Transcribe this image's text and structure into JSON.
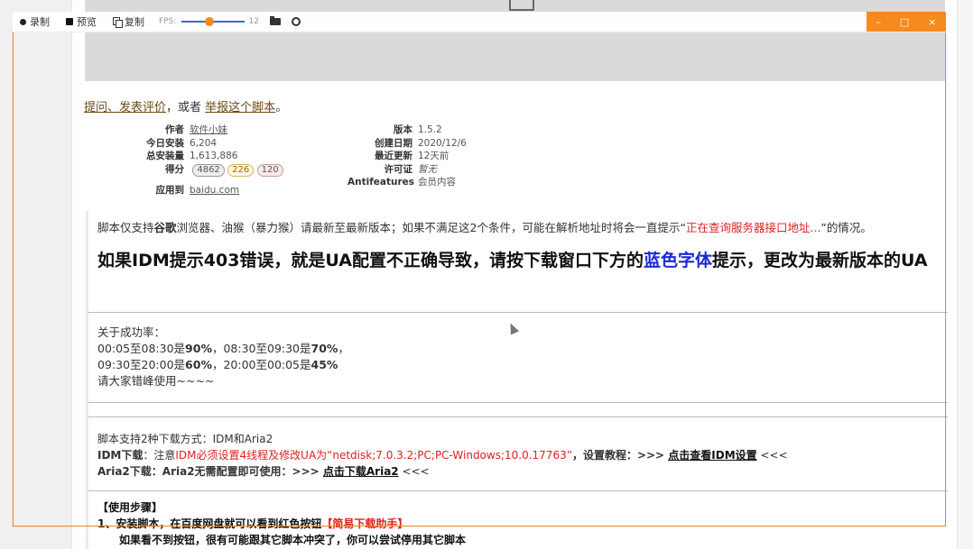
{
  "recorder": {
    "record_label": "录制",
    "preview_label": "预览",
    "copy_label": "复制",
    "fps_label": "FPS:",
    "fps_value": "12",
    "fps_fraction": 0.43,
    "minimize": "–",
    "maximize": "□",
    "close": "×",
    "accent": "#f58a1f"
  },
  "links": {
    "ask": "提问、发表评价",
    "or": "，或者",
    "report": "举报这个脚本",
    "end": "。"
  },
  "meta_left": [
    {
      "k": "作者",
      "v": "软件小妹"
    },
    {
      "k": "今日安装",
      "v": "6,204"
    },
    {
      "k": "总安装量",
      "v": "1,613,886"
    },
    {
      "k": "得分",
      "v": ""
    }
  ],
  "score": {
    "good": "4862",
    "ok": "226",
    "bad": "120"
  },
  "applies": {
    "k": "应用到",
    "v": "baidu.com"
  },
  "meta_right": [
    {
      "k": "版本",
      "v": "1.5.2"
    },
    {
      "k": "创建日期",
      "v": "2020/12/6"
    },
    {
      "k": "最近更新",
      "v": "12天前"
    },
    {
      "k": "许可证",
      "v": "暂无"
    },
    {
      "k": "Antifeatures",
      "v": "会员内容"
    }
  ],
  "desc": {
    "p1_a": "脚本仅支持",
    "p1_b": "谷歌",
    "p1_c": "浏览器、油猴（暴力猴）请最新至最新版本；如果不满足这2个条件，可能在解析地址时将会一直提示“",
    "p1_red": "正在查询服务器接口地址...",
    "p1_d": "”的情况。",
    "h2_a": "如果IDM提示403错误，就是UA配置不正确导致，请按下载窗口下方的",
    "h2_blue": "蓝色字体",
    "h2_b": "提示，更改为最新版本的UA",
    "stats_title": "关于成功率：",
    "stats_line1_a": "00:05至08:30是",
    "stats_line1_b": "90%",
    "stats_line1_c": "，08:30至09:30是",
    "stats_line1_d": "70%",
    "stats_line1_e": "，",
    "stats_line2_a": "09:30至20:00是",
    "stats_line2_b": "60%",
    "stats_line2_c": "，20:00至00:05是",
    "stats_line2_d": "45%",
    "stats_line3": "请大家错峰使用~~~~",
    "dl_title": "脚本支持2种下载方式：IDM和Aria2",
    "idm_a": "IDM下载",
    "idm_b": "：注意",
    "idm_red": "IDM必须设置4线程及修改UA为“netdisk;7.0.3.2;PC;PC-Windows;10.0.17763”",
    "idm_c": "，设置教程：>>> ",
    "idm_link": "点击查看IDM设置",
    "idm_d": " <<<",
    "aria_a": "Aria2下载",
    "aria_b": "：Aria2无需配置即可使用：>>> ",
    "aria_link": "点击下载Aria2",
    "aria_c": " <<<",
    "steps_title": "【使用步骤】",
    "step1_a": "1、安装脚本，在百度网盘就可以看到红色按钮",
    "step1_red": "【简易下载助手】",
    "step1_sub": "如果看不到按钮，很有可能跟其它脚本冲突了，你可以尝试停用其它脚本"
  }
}
